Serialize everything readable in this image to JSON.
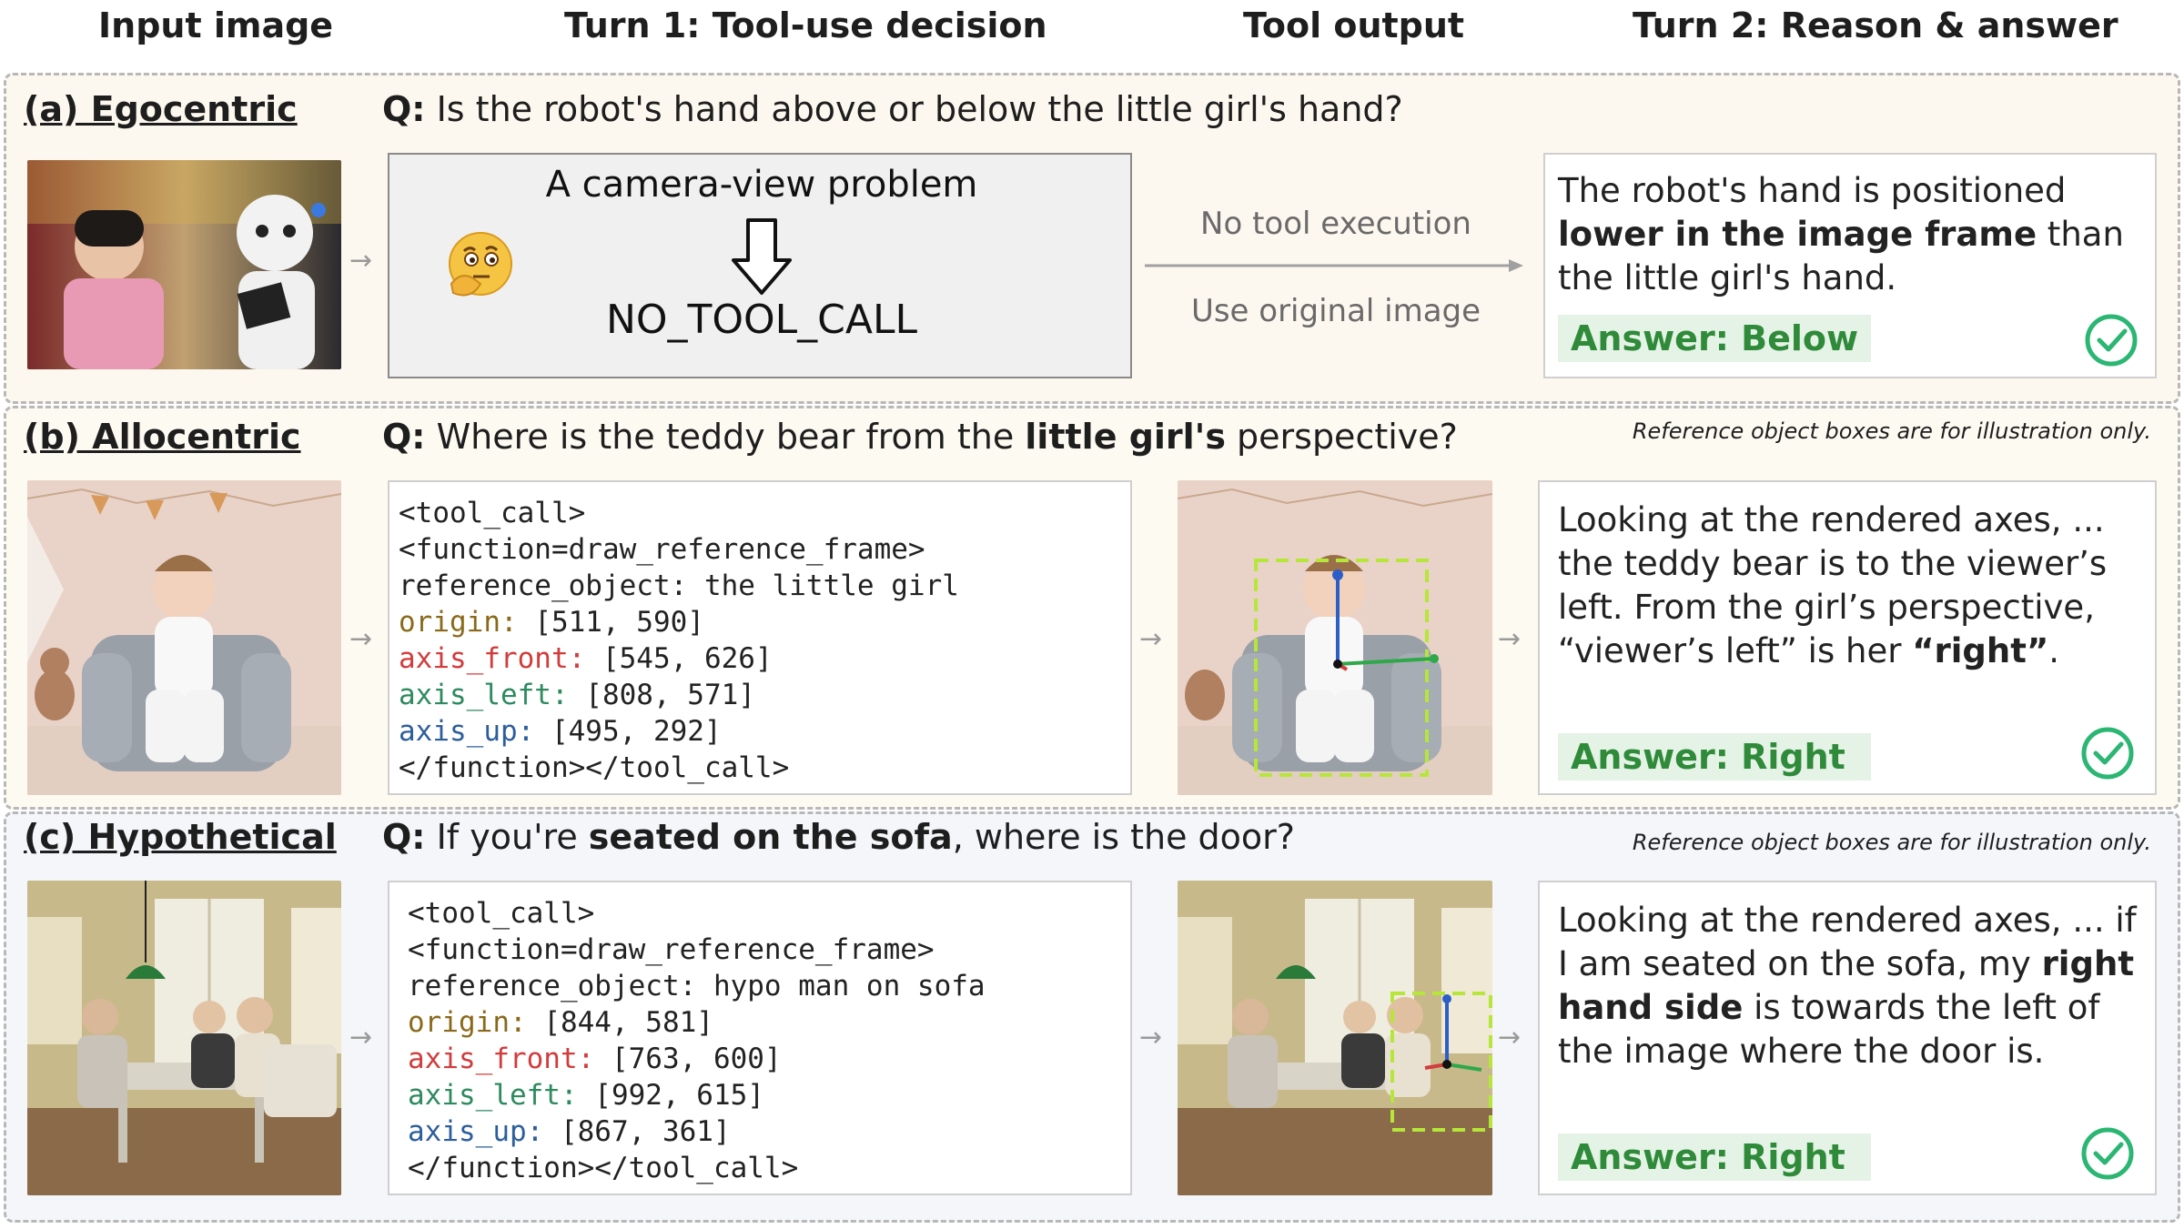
{
  "columns": {
    "input": "Input image",
    "turn1": "Turn 1: Tool-use decision",
    "tool_output": "Tool output",
    "turn2": "Turn 2: Reason & answer"
  },
  "sections": {
    "a": {
      "label": "(a) Egocentric",
      "q_prefix": "Q:",
      "question": "Is the robot's hand above or below the little girl's hand?",
      "decision_title": "A camera-view problem",
      "decision_result": "NO_TOOL_CALL",
      "tool_top": "No tool execution",
      "tool_bottom": "Use original image",
      "ans_1": "The robot's hand is positioned ",
      "ans_2": "lower in the image frame",
      "ans_3": " than the little girl's hand.",
      "answer": "Answer: Below"
    },
    "b": {
      "label": "(b) Allocentric",
      "q_prefix": "Q:",
      "q_1": "Where is the teddy bear from the ",
      "q_2": "little girl's",
      "q_3": " perspective?",
      "note": "Reference object boxes are for illustration only.",
      "code": {
        "l1": "<tool_call>",
        "l2": "<function=draw_reference_frame>",
        "l3": "reference_object: the little girl",
        "origin_key": "origin:",
        "origin_val": " [511, 590]",
        "front_key": "axis_front:",
        "front_val": " [545, 626]",
        "left_key": "axis_left:",
        "left_val": " [808, 571]",
        "up_key": "axis_up:",
        "up_val": " [495, 292]",
        "l8": "</function></tool_call>"
      },
      "ans_1": "Looking at the rendered axes, ... the teddy bear is to the viewer’s left. From the girl’s perspective, “viewer’s left” is her ",
      "ans_2": "“right”",
      "ans_3": ".",
      "answer": "Answer: Right"
    },
    "c": {
      "label": "(c) Hypothetical",
      "q_prefix": "Q:",
      "q_1": "If you're ",
      "q_2": "seated on the sofa",
      "q_3": ", where is the door?",
      "note": "Reference object boxes are for illustration only.",
      "code": {
        "l1": "<tool_call>",
        "l2": "<function=draw_reference_frame>",
        "l3": "reference_object: hypo man on sofa",
        "origin_key": "origin:",
        "origin_val": " [844, 581]",
        "front_key": "axis_front:",
        "front_val": " [763, 600]",
        "left_key": "axis_left:",
        "left_val": " [992, 615]",
        "up_key": "axis_up:",
        "up_val": " [867, 361]",
        "l8": "</function></tool_call>"
      },
      "ans_1": "Looking at the rendered axes, ... if I am seated on the sofa, my ",
      "ans_2": "right hand side",
      "ans_3": " is towards the left of the image where the door is.",
      "answer": "Answer: Right"
    }
  },
  "colors": {
    "answer_green": "#2f8a3a",
    "check_green": "#2bb673",
    "front_red": "#d23c3c",
    "left_green": "#2f8a60",
    "up_blue": "#2d5e9c",
    "origin_brown": "#8a6a1a"
  }
}
